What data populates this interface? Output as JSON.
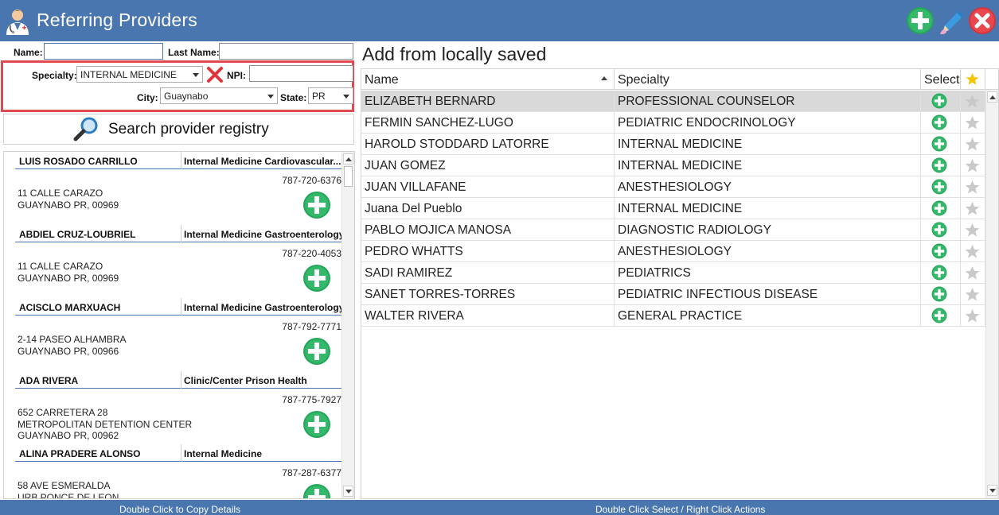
{
  "window": {
    "title": "Referring Providers"
  },
  "form": {
    "name_label": "Name:",
    "name_value": "",
    "last_name_label": "Last Name:",
    "last_name_value": "",
    "specialty_label": "Specialty:",
    "specialty_value": "INTERNAL MEDICINE",
    "npi_label": "NPI:",
    "npi_value": "",
    "city_label": "City:",
    "city_value": "Guaynabo",
    "state_label": "State:",
    "state_value": "PR"
  },
  "search": {
    "label": "Search provider registry"
  },
  "registry": [
    {
      "name": "LUIS ROSADO CARRILLO",
      "specialty": "Internal Medicine Cardiovascular...",
      "phone": "787-720-6376",
      "address": [
        "11 CALLE CARAZO",
        "GUAYNABO PR, 00969"
      ]
    },
    {
      "name": "ABDIEL CRUZ-LOUBRIEL",
      "specialty": "Internal Medicine Gastroenterology",
      "phone": "787-220-4053",
      "address": [
        "11 CALLE CARAZO",
        "GUAYNABO PR, 00969"
      ]
    },
    {
      "name": "ACISCLO MARXUACH",
      "specialty": "Internal Medicine Gastroenterology",
      "phone": "787-792-7771",
      "address": [
        "2-14 PASEO ALHAMBRA",
        "GUAYNABO PR, 00966"
      ]
    },
    {
      "name": "ADA RIVERA",
      "specialty": "Clinic/Center Prison Health",
      "phone": "787-775-7927",
      "address": [
        "652 CARRETERA 28",
        "METROPOLITAN DETENTION CENTER",
        "GUAYNABO PR, 00962"
      ]
    },
    {
      "name": "ALINA PRADERE ALONSO",
      "specialty": "Internal Medicine",
      "phone": "787-287-6377",
      "address": [
        "58 AVE ESMERALDA",
        "URB PONCE DE LEON"
      ]
    }
  ],
  "saved": {
    "title": "Add from locally saved",
    "columns": {
      "name": "Name",
      "specialty": "Specialty",
      "select": "Select"
    },
    "rows": [
      {
        "name": "ELIZABETH BERNARD",
        "specialty": "PROFESSIONAL COUNSELOR",
        "selected": true
      },
      {
        "name": "FERMIN SANCHEZ-LUGO",
        "specialty": "PEDIATRIC ENDOCRINOLOGY"
      },
      {
        "name": "HAROLD STODDARD LATORRE",
        "specialty": "INTERNAL MEDICINE"
      },
      {
        "name": "JUAN GOMEZ",
        "specialty": "INTERNAL MEDICINE"
      },
      {
        "name": "JUAN VILLAFANE",
        "specialty": "ANESTHESIOLOGY"
      },
      {
        "name": "Juana  Del Pueblo",
        "specialty": "INTERNAL MEDICINE"
      },
      {
        "name": "PABLO MOJICA MANOSA",
        "specialty": "DIAGNOSTIC RADIOLOGY"
      },
      {
        "name": "PEDRO WHATTS",
        "specialty": "ANESTHESIOLOGY"
      },
      {
        "name": "SADI RAMIREZ",
        "specialty": "PEDIATRICS"
      },
      {
        "name": "SANET TORRES-TORRES",
        "specialty": "PEDIATRIC INFECTIOUS DISEASE"
      },
      {
        "name": "WALTER RIVERA",
        "specialty": "GENERAL PRACTICE"
      }
    ]
  },
  "status": {
    "left": "Double Click to Copy Details",
    "right": "Double Click Select / Right Click Actions"
  },
  "colors": {
    "titlebar": "#4a76b0",
    "accent_green": "#27a35c",
    "highlight_red": "#e0494f",
    "star_gold": "#f5c400"
  },
  "icons": {
    "title": "doctor-icon",
    "add": "plus-icon",
    "edit": "pencil-icon",
    "close": "close-icon",
    "clear": "red-x-icon",
    "search": "magnifier-icon",
    "favorite": "star-icon"
  }
}
